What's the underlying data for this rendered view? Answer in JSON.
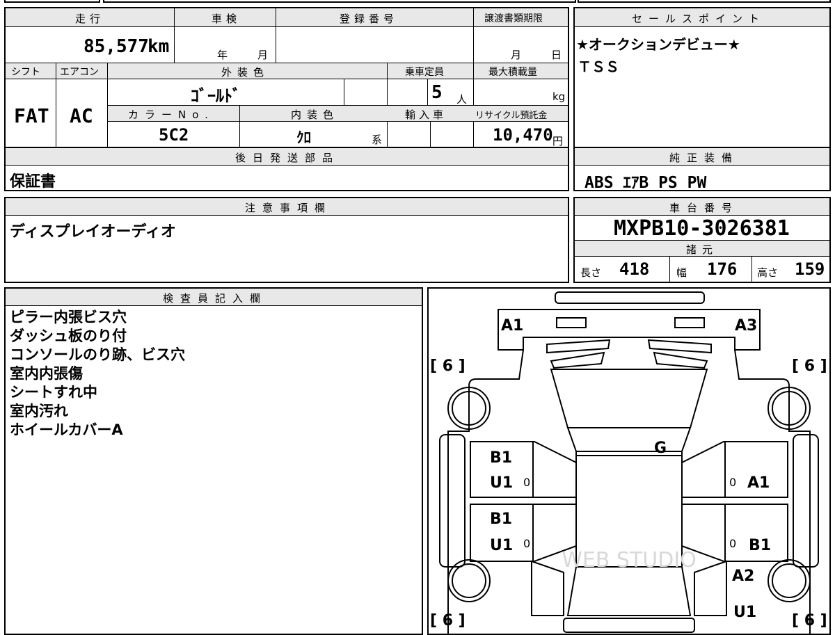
{
  "vehicle": {
    "mileage_label": "走行",
    "mileage_value": "85,577",
    "mileage_unit": "km",
    "inspection_label": "車検",
    "inspection_year_unit": "年",
    "inspection_month_unit": "月",
    "registration_label": "登録番号",
    "registration_value": "",
    "transfer_label": "譲渡書類期限",
    "transfer_month_unit": "月",
    "transfer_day_unit": "日",
    "shift_label": "シフト",
    "shift_value": "FAT",
    "ac_label": "エアコン",
    "ac_value": "AC",
    "exterior_label": "外装色",
    "exterior_value": "ｺﾞｰﾙﾄﾞ",
    "capacity_label": "乗車定員",
    "capacity_value": "5",
    "capacity_unit": "人",
    "load_label": "最大積載量",
    "load_unit": "kg",
    "color_no_label": "カラーNo.",
    "color_no_value": "5C2",
    "interior_label": "内装色",
    "interior_value": "ｸﾛ",
    "interior_suffix": "系",
    "import_label": "輸入車",
    "recycle_label": "リサイクル預託金",
    "recycle_value": "10,470",
    "recycle_unit": "円"
  },
  "sales_point": {
    "title": "セールスポイント",
    "lines": [
      "★オークションデビュー★",
      "ＴＳＳ"
    ]
  },
  "later_parts": {
    "title": "後日発送部品",
    "value": "保証書"
  },
  "equipment": {
    "title": "純正装備",
    "value": "ABS ｴｱB PS PW"
  },
  "notes": {
    "title": "注意事項欄",
    "value": "ディスプレイオーディオ"
  },
  "chassis": {
    "title": "車台番号",
    "value": "MXPB10-3026381"
  },
  "dimensions": {
    "title": "諸元",
    "length_label": "長さ",
    "length_value": "418",
    "width_label": "幅",
    "width_value": "176",
    "height_label": "高さ",
    "height_value": "159"
  },
  "inspector": {
    "title": "検査員記入欄",
    "lines": [
      "ピラー内張ビス穴",
      "ダッシュ板のり付",
      "コンソールのり跡、ビス穴",
      "室内内張傷",
      "シートすれ中",
      "室内汚れ",
      "ホイールカバーA"
    ]
  },
  "diagram": {
    "marks": {
      "front_left": "A1",
      "front_right": "A3",
      "glass": "G",
      "left_front_door_top": "B1",
      "left_front_door_bottom": "U1",
      "left_rear_door_top": "B1",
      "left_rear_door_bottom": "U1",
      "right_front_door": "A1",
      "right_rear_door": "B1",
      "right_rear_fender": "A2",
      "right_rear_bottom": "U1",
      "tire_tl": "[ 6 ]",
      "tire_tr": "[ 6 ]",
      "tire_bl": "[ 6 ]",
      "tire_br": "[ 6 ]",
      "zero": "0"
    },
    "watermark": "WEB STUDIO"
  }
}
